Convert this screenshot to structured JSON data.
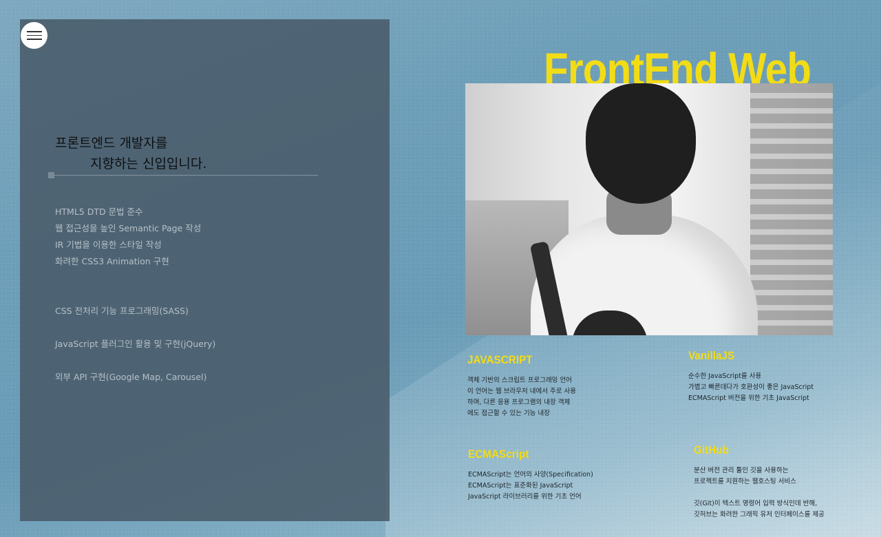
{
  "menu": {
    "icon": "hamburger-icon"
  },
  "intro": {
    "line1": "프론트엔드 개발자를",
    "line2": "지향하는 신입입니다."
  },
  "skills": [
    {
      "text": "HTML5 DTD 문법 준수",
      "faded": false
    },
    {
      "text": "웹 접근성을 높인 Semantic Page 작성",
      "faded": false
    },
    {
      "text": "IR 기법을 이용한 스타일 작성",
      "faded": false
    },
    {
      "text": "화려한 CSS3 Animation 구현",
      "faded": false
    },
    {
      "text": "",
      "faded": true
    },
    {
      "text": "",
      "faded": true
    },
    {
      "text": "CSS 전처리 기능 프로그래밍(SASS)",
      "faded": false
    },
    {
      "text": "",
      "faded": true
    },
    {
      "text": "JavaScript 플러그인 활용 및 구현(jQuery)",
      "faded": false
    },
    {
      "text": "",
      "faded": true
    },
    {
      "text": "외부 API 구현(Google Map, Carousel)",
      "faded": false
    },
    {
      "text": "",
      "faded": true
    },
    {
      "text": "",
      "faded": true
    },
    {
      "text": "",
      "faded": true
    },
    {
      "text": "",
      "faded": true
    }
  ],
  "hero": {
    "title": "FrontEnd Web"
  },
  "cards": {
    "javascript": {
      "title": "JAVASCRIPT",
      "lines": [
        "객체 기반의 스크립트 프로그래밍 언어",
        "이 언어는 웹 브라우저 내에서 주로 사용",
        "하며, 다른 응용 프로그램의 내장 객체",
        "에도 접근할 수 있는 기능 내장"
      ]
    },
    "vanillajs": {
      "title": "VanillaJS",
      "lines": [
        "순수한 JavaScript를 사용",
        "가볍고 빠른데다가 호환성이 좋은 JavaScript",
        "ECMAScript 버전을 위한 기초 JavaScript"
      ]
    },
    "ecmascript": {
      "title": "ECMAScript",
      "lines": [
        "ECMAScript는 언어의 사양(Specification)",
        "ECMAScript는 표준화된 JavaScript",
        "JavaScript 라이브러리를 위한 기초 언어"
      ]
    },
    "github": {
      "title": "GitHub",
      "lines": [
        "분산 버전 관리 툴인 깃을 사용하는",
        "프로젝트를 지원하는 웹호스팅 서비스"
      ],
      "lines2": [
        "깃(Git)이 텍스트 명령어 입력 방식인데 반해,",
        "깃허브는 화려한 그래픽 유저 인터페이스를 제공"
      ]
    }
  }
}
